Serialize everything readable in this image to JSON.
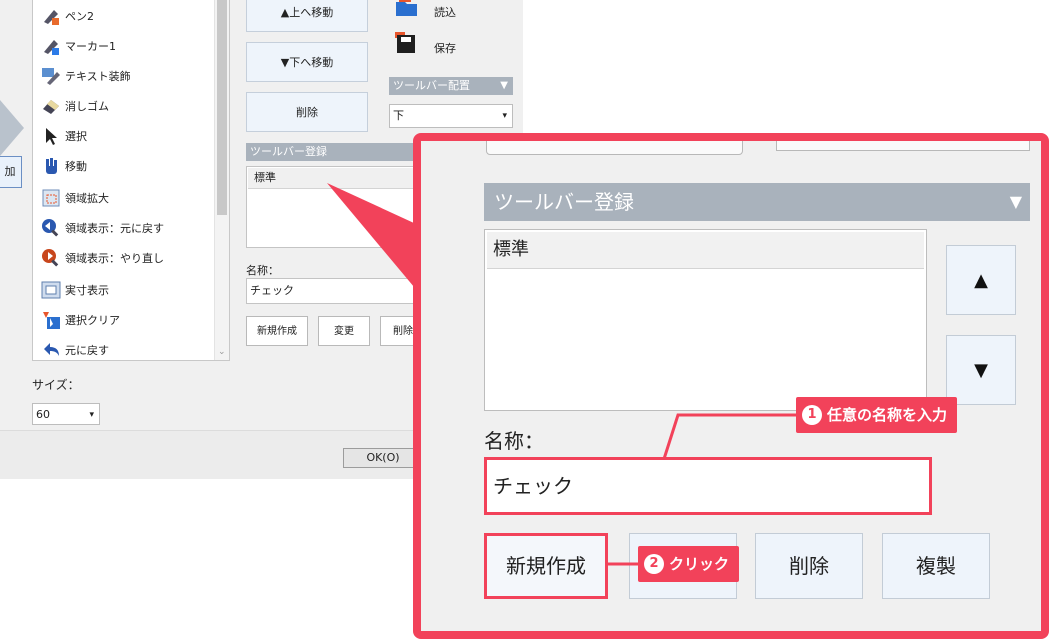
{
  "dialog": {
    "commands": [
      {
        "label": "ペン2",
        "icon": "pen-icon"
      },
      {
        "label": "マーカー1",
        "icon": "marker-icon"
      },
      {
        "label": "テキスト装飾",
        "icon": "text-decoration-icon"
      },
      {
        "label": "消しゴム",
        "icon": "eraser-icon"
      },
      {
        "label": "選択",
        "icon": "select-arrow-icon"
      },
      {
        "label": "移動",
        "icon": "hand-icon"
      },
      {
        "label": "領域拡大",
        "icon": "area-zoom-icon"
      },
      {
        "label": "領域表示：元に戻す",
        "icon": "zoom-undo-icon"
      },
      {
        "label": "領域表示：やり直し",
        "icon": "zoom-redo-icon"
      },
      {
        "label": "実寸表示",
        "icon": "actual-size-icon"
      },
      {
        "label": "選択クリア",
        "icon": "clear-selection-icon"
      },
      {
        "label": "元に戻す",
        "icon": "undo-icon"
      }
    ],
    "add_button": "加",
    "size_label": "サイズ：",
    "size_value": "60",
    "move_up": "▲上へ移動",
    "move_down": "▼下へ移動",
    "delete": "削除",
    "load": "読込",
    "save": "保存",
    "toolbar_position_header": "ツールバー配置",
    "toolbar_position_value": "下",
    "toolbar_register_header": "ツールバー登録",
    "register_list": [
      "標準"
    ],
    "name_label": "名称：",
    "name_value": "チェック",
    "new_button": "新規作成",
    "change_button": "変更",
    "delete_button_partial": "削除",
    "ok_button": "OK(O)"
  },
  "zoom": {
    "header": "ツールバー登録",
    "list": [
      "標準"
    ],
    "up_arrow": "▲",
    "down_arrow": "▼",
    "name_label": "名称：",
    "name_value": "チェック",
    "buttons": {
      "new": "新規作成",
      "change": "",
      "delete": "削除",
      "duplicate": "複製"
    }
  },
  "annotations": {
    "step1": {
      "number": "1",
      "text": "任意の名称を入力"
    },
    "step2": {
      "number": "2",
      "text": "クリック"
    }
  },
  "colors": {
    "accent": "#f2425a",
    "header_gray": "#a9b2bc",
    "button_bg": "#eef4fb"
  }
}
